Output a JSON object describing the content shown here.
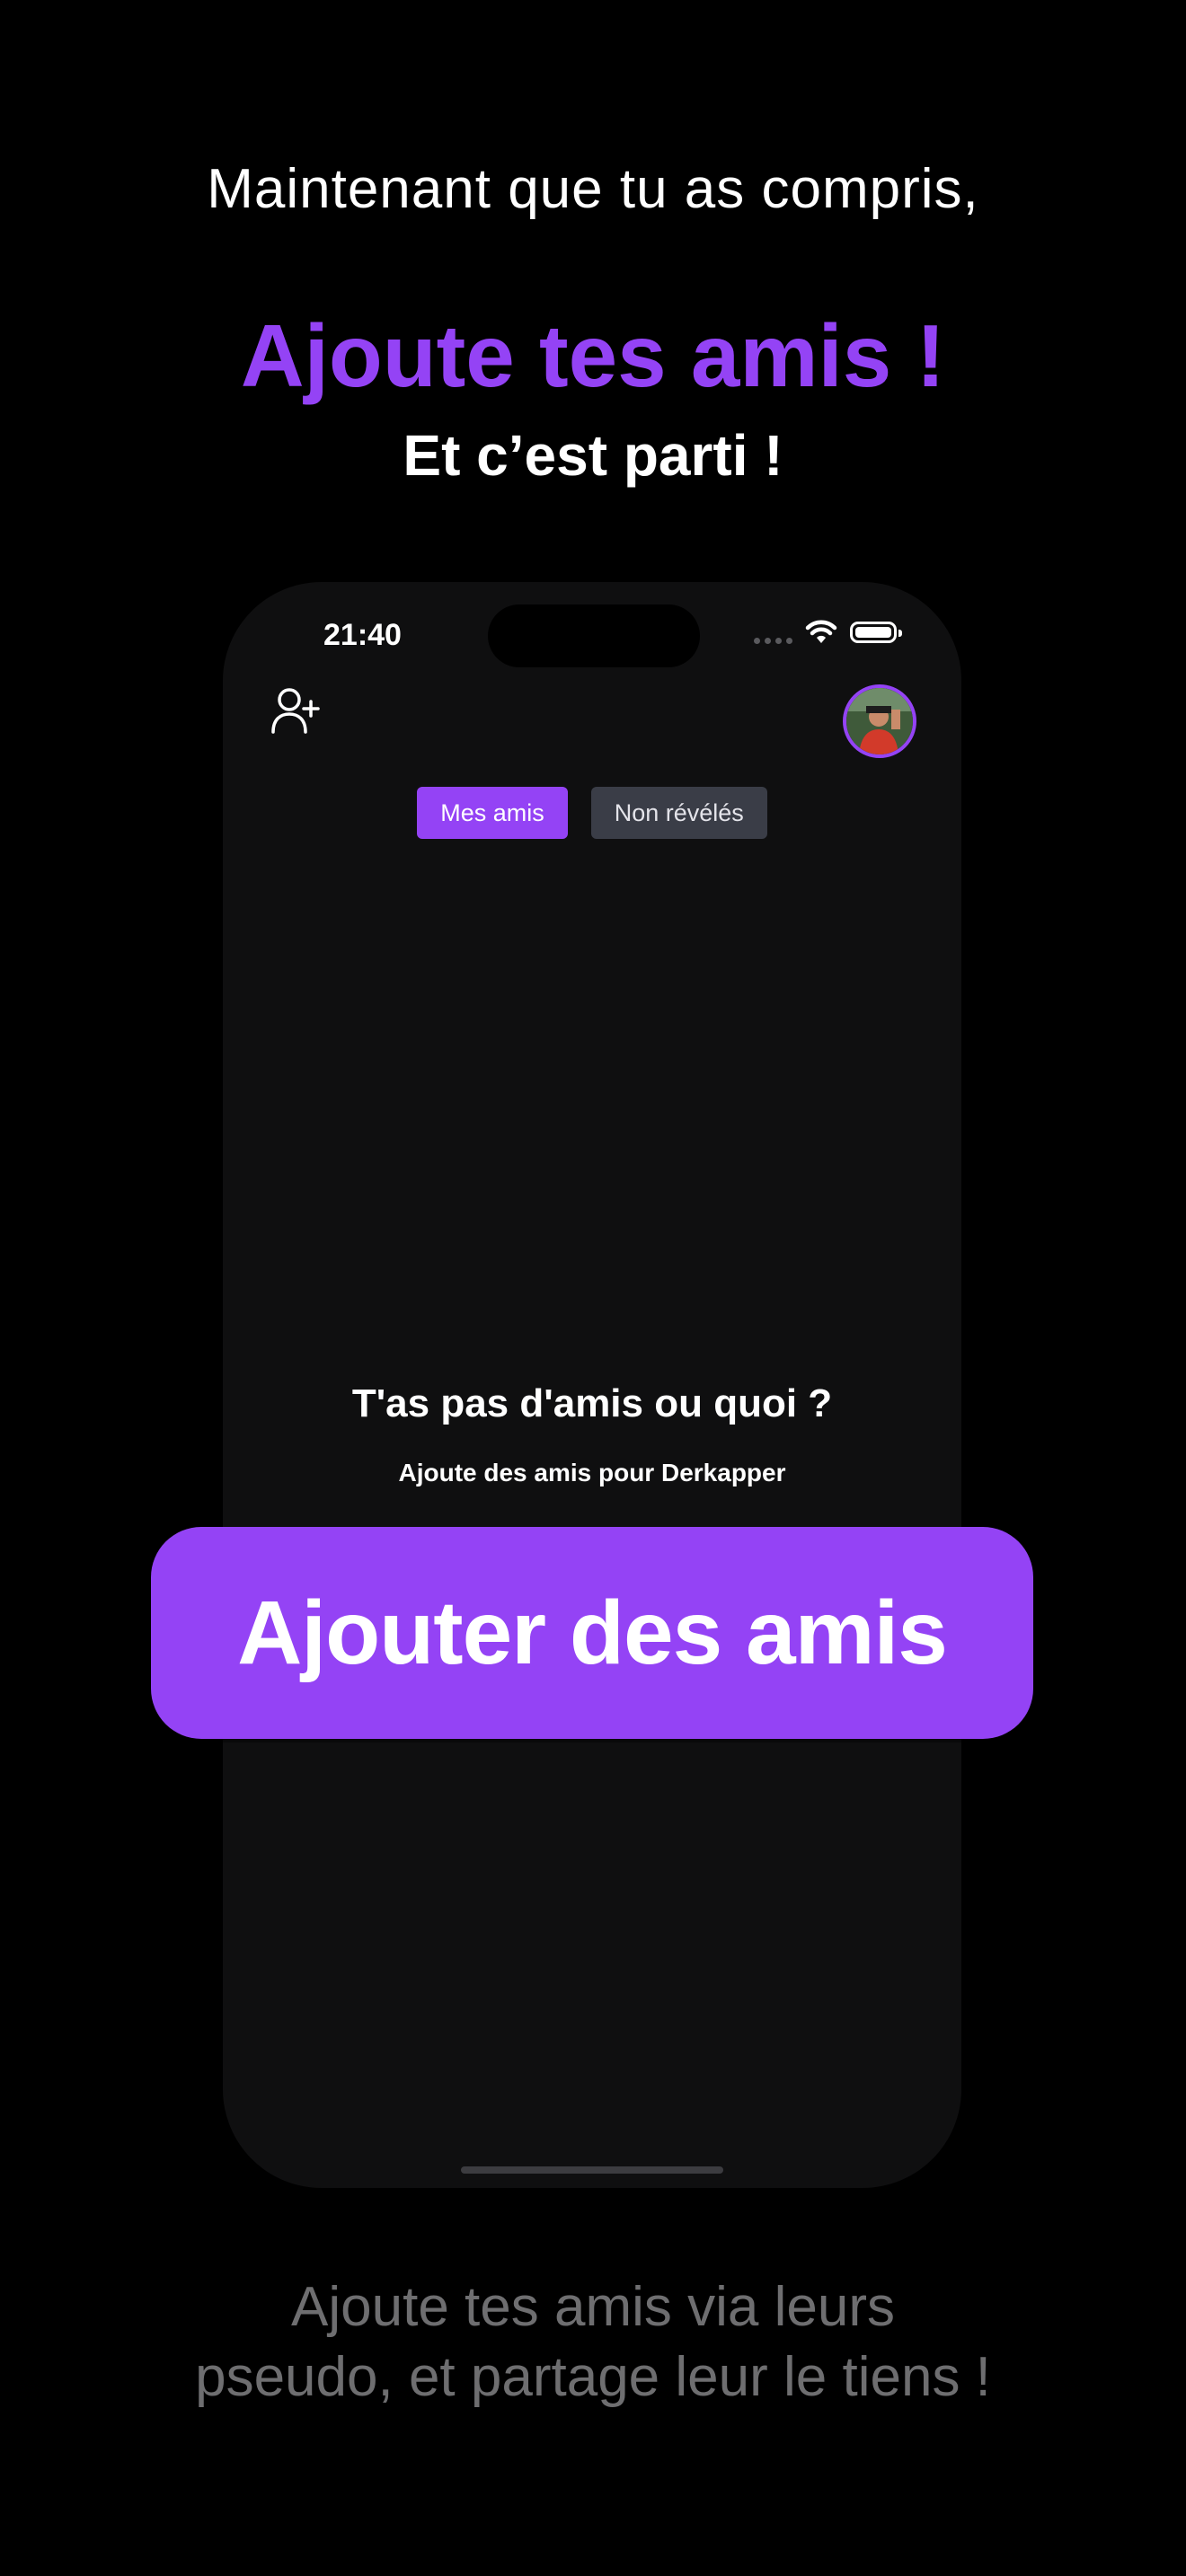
{
  "intro": "Maintenant que tu as compris,",
  "headline": "Ajoute tes amis !",
  "subheadline": "Et c’est parti !",
  "phone": {
    "status_time": "21:40",
    "tabs": [
      {
        "label": "Mes amis",
        "active": true
      },
      {
        "label": "Non révélés",
        "active": false
      }
    ],
    "empty_title": "T'as pas d'amis ou quoi ?",
    "empty_subtitle": "Ajoute des amis pour Derkapper"
  },
  "cta_label": "Ajouter des amis",
  "footer_line1": "Ajoute tes amis via leurs",
  "footer_line2": "pseudo, et partage leur le tiens !",
  "colors": {
    "accent": "#9443f5",
    "background": "#000000",
    "phone_screen": "#0f0f10",
    "inactive_tab": "#3a3d47",
    "footer_text": "#6e6e70"
  },
  "icons": [
    "wifi-icon",
    "battery-icon",
    "add-user-icon",
    "avatar"
  ]
}
